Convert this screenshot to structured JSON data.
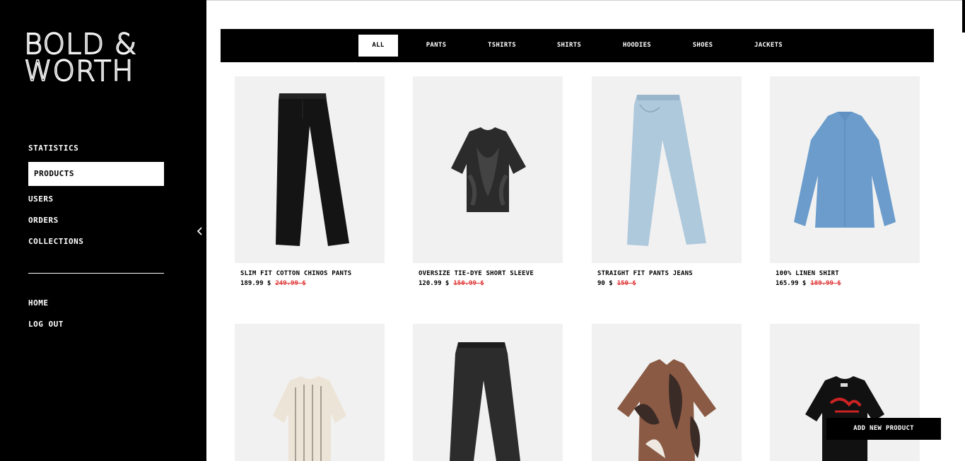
{
  "brand": {
    "line1": "BOLD &",
    "line2": "WORTH"
  },
  "sidebar": {
    "items": [
      {
        "label": "STATISTICS"
      },
      {
        "label": "PRODUCTS"
      },
      {
        "label": "USERS"
      },
      {
        "label": "ORDERS"
      },
      {
        "label": "COLLECTIONS"
      }
    ],
    "secondary": [
      {
        "label": "HOME"
      },
      {
        "label": "LOG OUT"
      }
    ],
    "active": "PRODUCTS",
    "collapse_icon": "chevron-left-icon"
  },
  "filters": {
    "tabs": [
      "ALL",
      "PANTS",
      "TSHIRTS",
      "SHIRTS",
      "HOODIES",
      "SHOES",
      "JACKETS"
    ],
    "active": "ALL"
  },
  "products": [
    {
      "name": "SLIM FIT COTTON CHINOS PANTS",
      "price": "189.99 $",
      "old_price": "249.99 $",
      "image": "black-trousers"
    },
    {
      "name": "OVERSIZE TIE-DYE SHORT SLEEVE",
      "price": "120.99 $",
      "old_price": "150.99 $",
      "image": "tie-dye-tshirt"
    },
    {
      "name": "STRAIGHT FIT PANTS JEANS",
      "price": "90 $",
      "old_price": "150 $",
      "image": "light-blue-jeans"
    },
    {
      "name": "100% LINEN SHIRT",
      "price": "165.99 $",
      "old_price": "189.99 $",
      "image": "blue-linen-shirt"
    },
    {
      "image": "knit-tshirt"
    },
    {
      "image": "black-jeans"
    },
    {
      "image": "leaf-print-shirt"
    },
    {
      "image": "graphic-tshirt"
    }
  ],
  "actions": {
    "add_new_product": "ADD NEW PRODUCT"
  },
  "colors": {
    "sidebar_bg": "#000000",
    "accent_old_price": "#e03a3a",
    "card_bg": "#f1f1f1"
  }
}
